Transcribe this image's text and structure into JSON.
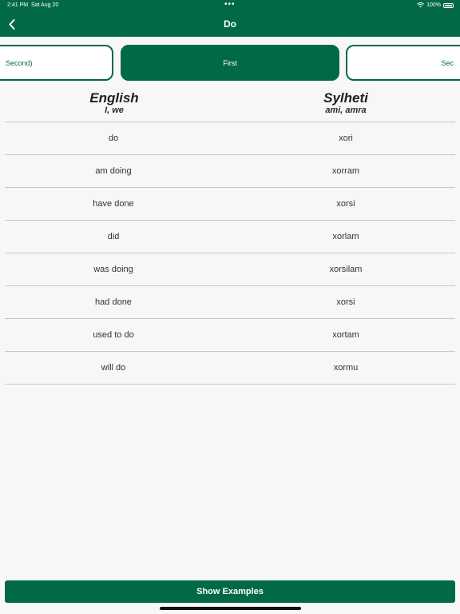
{
  "status_bar": {
    "time": "2:41 PM",
    "date": "Sat Aug 20",
    "battery": "100%",
    "dots": "•••"
  },
  "nav": {
    "title": "Do",
    "back_icon": "chevron-left-icon"
  },
  "tabs": [
    {
      "label": "Second)"
    },
    {
      "label": "First"
    },
    {
      "label": "Sec"
    }
  ],
  "headers": {
    "english": {
      "title": "English",
      "subtitle": "I, we"
    },
    "sylheti": {
      "title": "Sylheti",
      "subtitle": "ami, amra"
    }
  },
  "rows": [
    {
      "english": "do",
      "sylheti": "xori"
    },
    {
      "english": "am doing",
      "sylheti": "xorram"
    },
    {
      "english": "have done",
      "sylheti": "xorsi"
    },
    {
      "english": "did",
      "sylheti": "xorlam"
    },
    {
      "english": "was doing",
      "sylheti": "xorsilam"
    },
    {
      "english": "had done",
      "sylheti": "xorsi"
    },
    {
      "english": "used to do",
      "sylheti": "xortam"
    },
    {
      "english": "will do",
      "sylheti": "xormu"
    }
  ],
  "footer": {
    "button_label": "Show Examples"
  },
  "colors": {
    "primary": "#026948",
    "background": "#f7f7f7",
    "divider": "#c8c8c8"
  }
}
